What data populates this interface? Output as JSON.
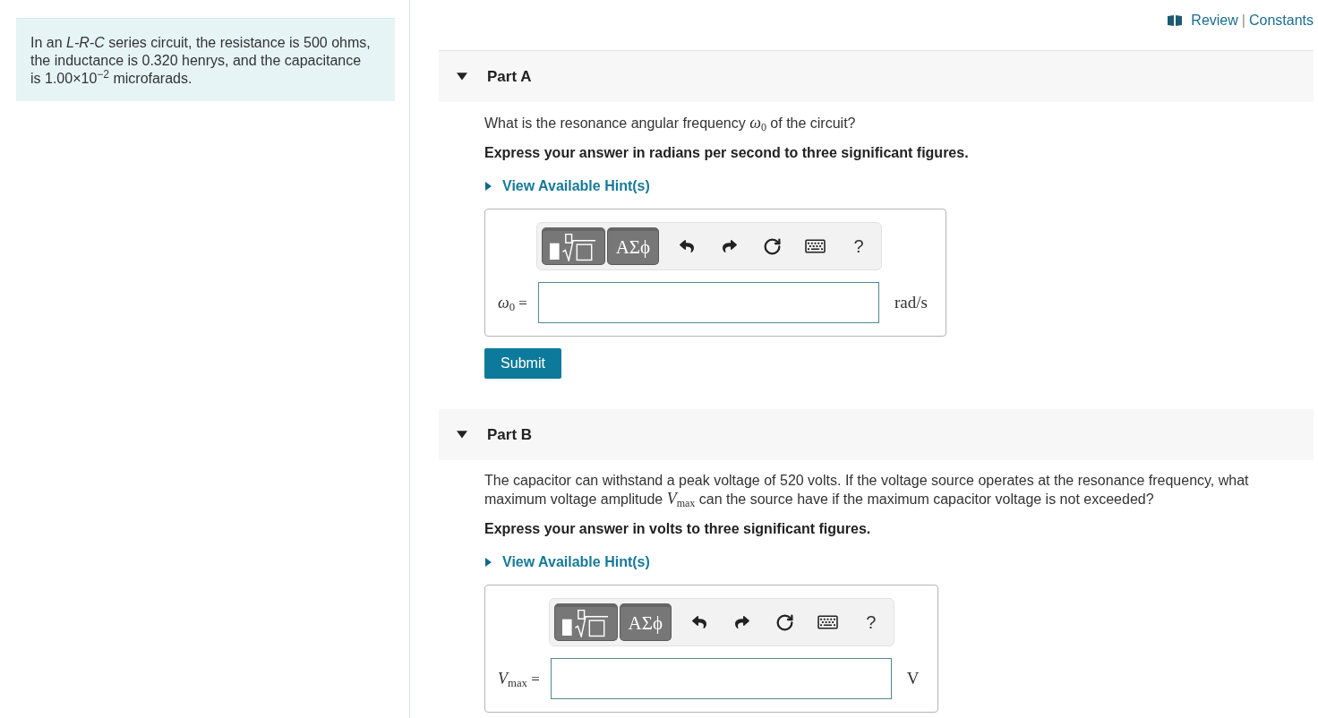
{
  "problem": {
    "text": "In an *L-R-C* series circuit, the resistance is 500 ohms, the inductance is 0.320 henrys, and the capacitance is 1.00×10$^{−2}$ microfarads."
  },
  "header": {
    "links": [
      {
        "label": "Review"
      },
      {
        "label": "Constants"
      }
    ],
    "separator": "|"
  },
  "parts": [
    {
      "title": "Part A",
      "expanded": true,
      "question": "What is the resonance angular frequency *ω*$_{0}$ of the circuit?",
      "instruction": "Express your answer in radians per second to three significant figures.",
      "hint": {
        "label": "View Available Hint(s)",
        "expanded": false
      },
      "toolbar": [
        {
          "kind": "template"
        },
        {
          "kind": "greek",
          "label": "ΑΣϕ"
        },
        {
          "kind": "undo"
        },
        {
          "kind": "redo"
        },
        {
          "kind": "reset"
        },
        {
          "kind": "keyboard"
        },
        {
          "kind": "help",
          "label": "?"
        }
      ],
      "answer": {
        "label": "*ω*$_{0}$ =",
        "unit": "rad/s"
      },
      "submit": "Submit"
    },
    {
      "title": "Part B",
      "expanded": true,
      "question": "The capacitor can withstand a peak voltage of 520 volts. If the voltage source operates at the resonance frequency, what maximum voltage amplitude *V*$_{max}$ can the source have if the maximum capacitor voltage is not exceeded?",
      "instruction": "Express your answer in volts to three significant figures.",
      "hint": {
        "label": "View Available Hint(s)",
        "expanded": false
      },
      "toolbar": [
        {
          "kind": "template"
        },
        {
          "kind": "greek",
          "label": "ΑΣϕ"
        },
        {
          "kind": "undo"
        },
        {
          "kind": "redo"
        },
        {
          "kind": "reset"
        },
        {
          "kind": "keyboard"
        },
        {
          "kind": "help",
          "label": "?"
        }
      ],
      "answer": {
        "label": "*V*$_{max}$ =",
        "unit": "V"
      }
    }
  ]
}
